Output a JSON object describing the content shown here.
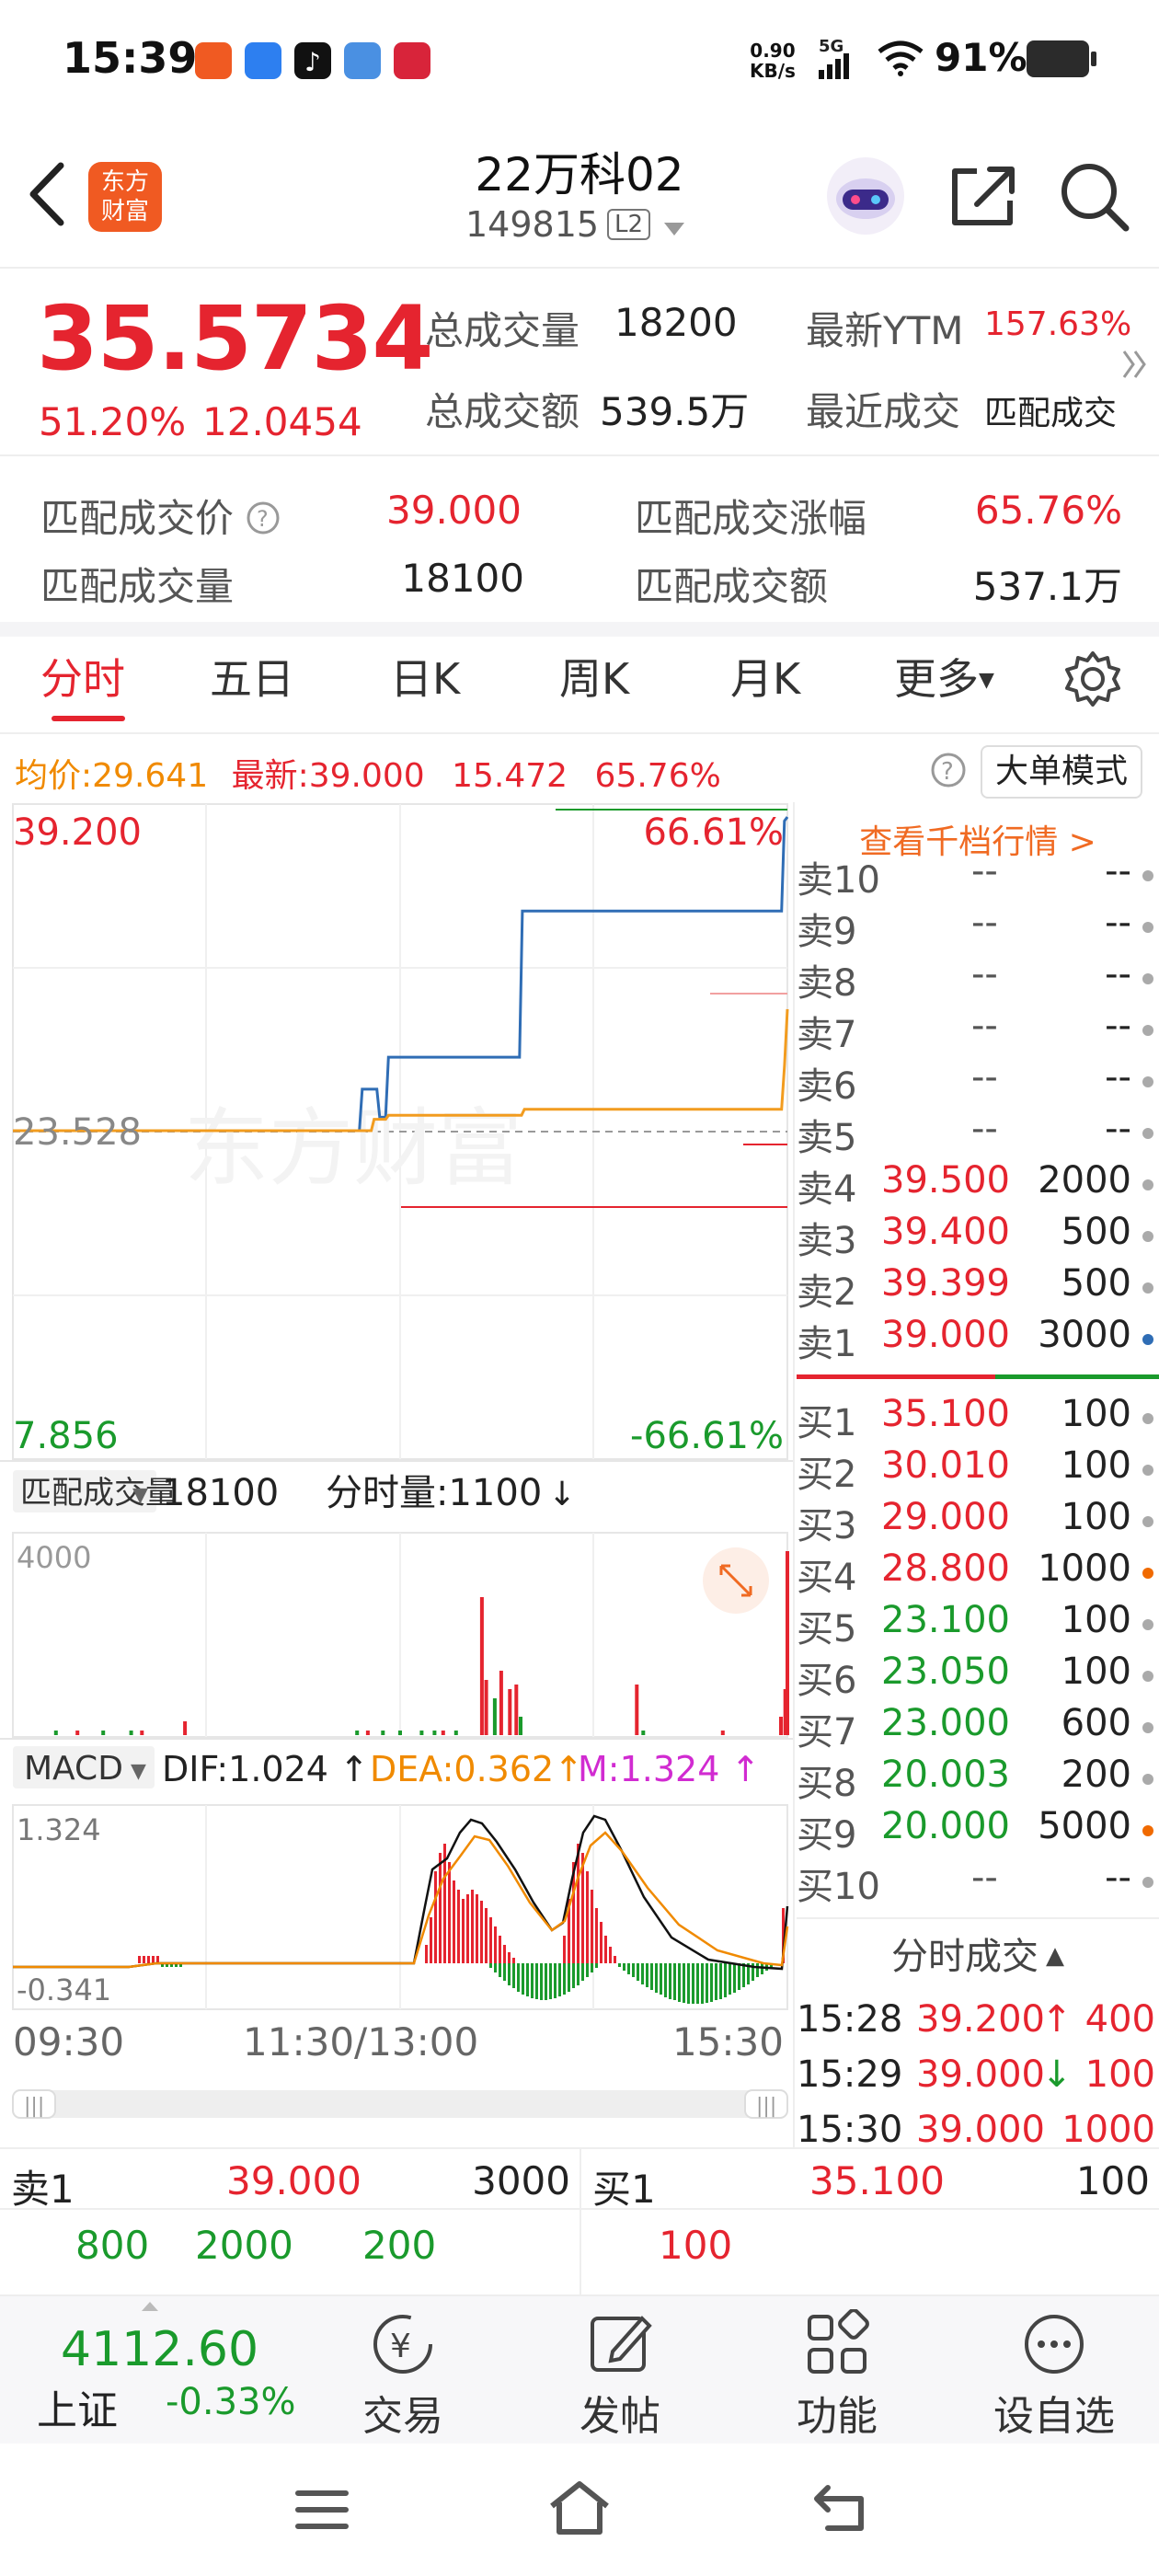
{
  "status_bar": {
    "time": "15:39",
    "net_speed": "0.90",
    "net_unit": "KB/s",
    "signal": "5G",
    "battery": "91%"
  },
  "header": {
    "title": "22万科02",
    "code": "149815",
    "level_badge": "L2",
    "logo_line1": "东方",
    "logo_line2": "财富"
  },
  "quote": {
    "price": "35.5734",
    "change_pct": "51.20%",
    "change_amt": "12.0454",
    "total_volume_label": "总成交量",
    "total_volume": "18200",
    "total_amount_label": "总成交额",
    "total_amount": "539.5万",
    "ytm_label": "最新YTM",
    "ytm": "157.63%",
    "recent_trade_label": "最近成交",
    "recent_trade": "匹配成交"
  },
  "match": {
    "price_label": "匹配成交价",
    "price": "39.000",
    "rise_label": "匹配成交涨幅",
    "rise": "65.76%",
    "volume_label": "匹配成交量",
    "volume": "18100",
    "amount_label": "匹配成交额",
    "amount": "537.1万"
  },
  "tabs": [
    "分时",
    "五日",
    "日K",
    "周K",
    "月K",
    "更多"
  ],
  "chart_info": {
    "avg_label": "均价:",
    "avg": "29.641",
    "latest_label": "最新:",
    "latest": "39.000",
    "chg": "15.472",
    "chg_pct": "65.76%",
    "mode_button": "大单模式",
    "orderbook_link": "查看千档行情 >"
  },
  "chart_data": [
    {
      "type": "line",
      "y_top": "39.200",
      "y_mid": "23.528",
      "y_bottom": "7.856",
      "pct_top": "66.61%",
      "pct_bottom": "-66.61%",
      "watermark": "东方财富",
      "ylim": [
        7.856,
        39.2
      ],
      "x_labels": [
        "09:30",
        "11:30/13:00",
        "15:30"
      ],
      "series": [
        {
          "color": "#2f6db5",
          "values": [
            23.528,
            23.528,
            23.528,
            23.528,
            23.528,
            23.528,
            23.528,
            23.528,
            23.528,
            23.528,
            23.528,
            23.528,
            23.528,
            23.528,
            23.528,
            23.528,
            23.528,
            23.528,
            23.528,
            23.528,
            23.528,
            23.528,
            23.528,
            23.528,
            23.528,
            23.528,
            23.528,
            23.528,
            23.528,
            23.528,
            23.528,
            23.528,
            23.528,
            23.528,
            23.528,
            23.528,
            23.528,
            23.528,
            23.528,
            23.528,
            23.528,
            23.528,
            23.528,
            23.528,
            23.528,
            23.528,
            23.528,
            23.528,
            23.528,
            23.528,
            23.528,
            23.528,
            23.528,
            23.528,
            23.528,
            23.528,
            23.528,
            23.528,
            23.528,
            23.528,
            23.528,
            23.528,
            23.528,
            23.528,
            23.528,
            23.528,
            23.528,
            23.528,
            23.528,
            23.528,
            23.528,
            23.528,
            23.528,
            23.528,
            23.528,
            23.528,
            23.528,
            23.528,
            23.528,
            23.528,
            23.528,
            23.528,
            23.528,
            23.528,
            23.528,
            23.528,
            23.528,
            23.528,
            23.528,
            23.528,
            23.528,
            23.528,
            23.528,
            23.528,
            23.528,
            23.528,
            23.528,
            23.528,
            23.528,
            23.528,
            23.528,
            23.528,
            23.528,
            23.528,
            23.528,
            23.528,
            23.528,
            23.528,
            23.528,
            23.528,
            23.528,
            23.528,
            23.528,
            23.528,
            23.528,
            23.528,
            23.528,
            23.528,
            23.528,
            23.528,
            25.6,
            25.6,
            25.6,
            25.6,
            25.6,
            25.6,
            24.2,
            24.2,
            24.2,
            27.2,
            27.2,
            27.2,
            27.2,
            27.2,
            27.2,
            27.2,
            27.2,
            27.2,
            27.2,
            27.2,
            27.2,
            27.2,
            27.2,
            27.2,
            27.2,
            27.2,
            27.2,
            27.2,
            27.2,
            27.2,
            27.2,
            27.2,
            27.2,
            27.2,
            27.2,
            27.2,
            27.2,
            27.2,
            27.2,
            27.2,
            27.2,
            27.2,
            27.2,
            27.2,
            27.2,
            27.2,
            27.2,
            27.2,
            27.2,
            27.2,
            27.2,
            27.2,
            27.2,
            27.2,
            27.2,
            34.5,
            34.5,
            34.5,
            34.5,
            34.5,
            34.5,
            34.5,
            34.5,
            34.5,
            34.5,
            34.5,
            34.5,
            34.5,
            34.5,
            34.5,
            34.5,
            34.5,
            34.5,
            34.5,
            34.5,
            34.5,
            34.5,
            34.5,
            34.5,
            34.5,
            34.5,
            34.5,
            34.5,
            34.5,
            34.5,
            34.5,
            34.5,
            34.5,
            34.5,
            34.5,
            34.5,
            34.5,
            34.5,
            34.5,
            34.5,
            34.5,
            34.5,
            34.5,
            34.5,
            34.5,
            34.5,
            34.5,
            34.5,
            34.5,
            34.5,
            34.5,
            34.5,
            34.5,
            34.5,
            34.5,
            34.5,
            34.5,
            34.5,
            34.5,
            34.5,
            34.5,
            34.5,
            34.5,
            34.5,
            34.5,
            34.5,
            34.5,
            34.5,
            34.5,
            34.5,
            34.5,
            34.5,
            34.5,
            34.5,
            34.5,
            34.5,
            34.5,
            34.5,
            34.5,
            34.5,
            34.5,
            34.5,
            34.5,
            34.5,
            34.5,
            34.5,
            34.5,
            34.5,
            34.5,
            34.5,
            39.0,
            39.2
          ]
        },
        {
          "color": "#f29c1f",
          "values": [
            23.528,
            23.528,
            23.528,
            23.528,
            23.528,
            23.528,
            23.528,
            23.528,
            23.528,
            23.528,
            23.528,
            23.528,
            23.528,
            23.528,
            23.528,
            23.528,
            23.528,
            23.528,
            23.528,
            23.528,
            23.528,
            23.528,
            23.528,
            23.528,
            23.528,
            23.528,
            23.528,
            23.528,
            23.528,
            23.528,
            23.528,
            23.528,
            23.528,
            23.528,
            23.528,
            23.528,
            23.528,
            23.528,
            23.528,
            23.528,
            23.528,
            23.528,
            23.528,
            23.528,
            23.528,
            23.528,
            23.528,
            23.528,
            23.528,
            23.528,
            23.528,
            23.528,
            23.528,
            23.528,
            23.528,
            23.528,
            23.528,
            23.528,
            23.528,
            23.528,
            23.528,
            23.528,
            23.528,
            23.528,
            23.528,
            23.528,
            23.528,
            23.528,
            23.528,
            23.528,
            23.528,
            23.528,
            23.528,
            23.528,
            23.528,
            23.528,
            23.528,
            23.528,
            23.528,
            23.528,
            23.528,
            23.528,
            23.528,
            23.528,
            23.528,
            23.528,
            23.528,
            23.528,
            23.528,
            23.528,
            23.528,
            23.528,
            23.528,
            23.528,
            23.528,
            23.528,
            23.528,
            23.528,
            23.528,
            23.528,
            23.528,
            23.528,
            23.528,
            23.528,
            23.528,
            23.528,
            23.528,
            23.528,
            23.528,
            23.528,
            23.528,
            23.528,
            23.528,
            23.528,
            23.528,
            23.528,
            23.528,
            23.528,
            23.528,
            23.528,
            23.528,
            23.528,
            23.528,
            23.528,
            23.528,
            24.1,
            24.1,
            24.1,
            24.1,
            24.1,
            24.3,
            24.3,
            24.3,
            24.3,
            24.3,
            24.3,
            24.3,
            24.3,
            24.3,
            24.3,
            24.3,
            24.3,
            24.3,
            24.3,
            24.3,
            24.3,
            24.3,
            24.3,
            24.3,
            24.3,
            24.3,
            24.3,
            24.3,
            24.3,
            24.3,
            24.3,
            24.3,
            24.3,
            24.3,
            24.3,
            24.3,
            24.3,
            24.3,
            24.3,
            24.3,
            24.3,
            24.3,
            24.3,
            24.3,
            24.3,
            24.3,
            24.3,
            24.3,
            24.3,
            24.3,
            24.3,
            24.3,
            24.6,
            24.6,
            24.6,
            24.6,
            24.6,
            24.6,
            24.6,
            24.6,
            24.6,
            24.6,
            24.6,
            24.6,
            24.6,
            24.6,
            24.6,
            24.6,
            24.6,
            24.6,
            24.6,
            24.6,
            24.6,
            24.6,
            24.6,
            24.6,
            24.6,
            24.6,
            24.6,
            24.6,
            24.6,
            24.6,
            24.6,
            24.6,
            24.6,
            24.6,
            24.6,
            24.6,
            24.6,
            24.6,
            24.6,
            24.6,
            24.6,
            24.6,
            24.6,
            24.6,
            24.6,
            24.6,
            24.6,
            24.6,
            24.6,
            24.6,
            24.6,
            24.6,
            24.6,
            24.6,
            24.6,
            24.6,
            24.6,
            24.6,
            24.6,
            24.6,
            24.6,
            24.6,
            24.6,
            24.6,
            24.6,
            24.6,
            24.6,
            24.6,
            24.6,
            24.6,
            24.6,
            24.6,
            24.6,
            24.6,
            24.6,
            24.6,
            24.6,
            24.6,
            24.6,
            24.6,
            24.6,
            24.6,
            24.6,
            24.6,
            24.6,
            24.6,
            24.6,
            24.6,
            24.6,
            24.6,
            26.8,
            29.6
          ]
        }
      ]
    },
    {
      "type": "bar",
      "title": "匹配成交量",
      "total": "18100",
      "per_minute_label": "分时量:1100",
      "ymax_label": "4000",
      "ylim": [
        0,
        4000
      ],
      "bars": [
        {
          "x": 20,
          "v": 100,
          "c": "g"
        },
        {
          "x": 30,
          "v": 100,
          "c": "r"
        },
        {
          "x": 42,
          "v": 100,
          "c": "g"
        },
        {
          "x": 55,
          "v": 100,
          "c": "g"
        },
        {
          "x": 60,
          "v": 100,
          "c": "r"
        },
        {
          "x": 80,
          "v": 300,
          "c": "r"
        },
        {
          "x": 160,
          "v": 100,
          "c": "g"
        },
        {
          "x": 165,
          "v": 100,
          "c": "r"
        },
        {
          "x": 172,
          "v": 100,
          "c": "g"
        },
        {
          "x": 180,
          "v": 100,
          "c": "g"
        },
        {
          "x": 190,
          "v": 100,
          "c": "g"
        },
        {
          "x": 196,
          "v": 100,
          "c": "g"
        },
        {
          "x": 200,
          "v": 100,
          "c": "r"
        },
        {
          "x": 206,
          "v": 100,
          "c": "g"
        },
        {
          "x": 218,
          "v": 3000,
          "c": "r"
        },
        {
          "x": 220,
          "v": 1200,
          "c": "r"
        },
        {
          "x": 224,
          "v": 800,
          "c": "g"
        },
        {
          "x": 227,
          "v": 1400,
          "c": "r"
        },
        {
          "x": 231,
          "v": 1000,
          "c": "r"
        },
        {
          "x": 234,
          "v": 1100,
          "c": "r"
        },
        {
          "x": 236,
          "v": 400,
          "c": "g"
        },
        {
          "x": 290,
          "v": 1100,
          "c": "r"
        },
        {
          "x": 293,
          "v": 100,
          "c": "g"
        },
        {
          "x": 330,
          "v": 100,
          "c": "r"
        },
        {
          "x": 357,
          "v": 400,
          "c": "r"
        },
        {
          "x": 359,
          "v": 1000,
          "c": "r"
        },
        {
          "x": 360,
          "v": 4000,
          "c": "r"
        }
      ]
    },
    {
      "type": "line",
      "title": "MACD",
      "dif_label": "DIF:1.024",
      "dea_label": "DEA:0.362",
      "m_label": "M:1.324",
      "ymax_label": "1.324",
      "ymin_label": "-0.341",
      "ylim": [
        -0.341,
        1.324
      ]
    }
  ],
  "orderbook": {
    "asks": [
      {
        "label": "卖10",
        "price": "--",
        "vol": "--",
        "dot": "#aaaaaa"
      },
      {
        "label": "卖9",
        "price": "--",
        "vol": "--",
        "dot": "#aaaaaa"
      },
      {
        "label": "卖8",
        "price": "--",
        "vol": "--",
        "dot": "#aaaaaa"
      },
      {
        "label": "卖7",
        "price": "--",
        "vol": "--",
        "dot": "#aaaaaa"
      },
      {
        "label": "卖6",
        "price": "--",
        "vol": "--",
        "dot": "#aaaaaa"
      },
      {
        "label": "卖5",
        "price": "--",
        "vol": "--",
        "dot": "#aaaaaa"
      },
      {
        "label": "卖4",
        "price": "39.500",
        "vol": "2000",
        "dot": "#aaaaaa"
      },
      {
        "label": "卖3",
        "price": "39.400",
        "vol": "500",
        "dot": "#aaaaaa"
      },
      {
        "label": "卖2",
        "price": "39.399",
        "vol": "500",
        "dot": "#aaaaaa"
      },
      {
        "label": "卖1",
        "price": "39.000",
        "vol": "3000",
        "dot": "#2f6db5"
      }
    ],
    "bids": [
      {
        "label": "买1",
        "price": "35.100",
        "vol": "100",
        "color": "red",
        "dot": "#aaaaaa"
      },
      {
        "label": "买2",
        "price": "30.010",
        "vol": "100",
        "color": "red",
        "dot": "#aaaaaa"
      },
      {
        "label": "买3",
        "price": "29.000",
        "vol": "100",
        "color": "red",
        "dot": "#aaaaaa"
      },
      {
        "label": "买4",
        "price": "28.800",
        "vol": "1000",
        "color": "red",
        "dot": "#f06a00"
      },
      {
        "label": "买5",
        "price": "23.100",
        "vol": "100",
        "color": "green",
        "dot": "#aaaaaa"
      },
      {
        "label": "买6",
        "price": "23.050",
        "vol": "100",
        "color": "green",
        "dot": "#aaaaaa"
      },
      {
        "label": "买7",
        "price": "23.000",
        "vol": "600",
        "color": "green",
        "dot": "#aaaaaa"
      },
      {
        "label": "买8",
        "price": "20.003",
        "vol": "200",
        "color": "green",
        "dot": "#aaaaaa"
      },
      {
        "label": "买9",
        "price": "20.000",
        "vol": "5000",
        "color": "green",
        "dot": "#f06a00"
      },
      {
        "label": "买10",
        "price": "--",
        "vol": "--",
        "color": "gray",
        "dot": "#aaaaaa"
      }
    ]
  },
  "trades": {
    "title": "分时成交",
    "rows": [
      {
        "time": "15:28",
        "price": "39.200",
        "arrow": "↑",
        "vol": "400",
        "vol_color": "red"
      },
      {
        "time": "15:29",
        "price": "39.000",
        "arrow": "↓",
        "vol": "100",
        "vol_color": "red"
      },
      {
        "time": "15:30",
        "price": "39.000",
        "arrow": "",
        "vol": "1000",
        "vol_color": "red"
      }
    ]
  },
  "level1": {
    "ask_label": "卖1",
    "ask_price": "39.000",
    "ask_vol": "3000",
    "bid_label": "买1",
    "bid_price": "35.100",
    "bid_vol": "100",
    "ask_details": [
      "800",
      "2000",
      "200"
    ],
    "bid_details": [
      "100"
    ]
  },
  "bottom_nav": {
    "index_value": "4112.60",
    "index_name": "上证",
    "index_change": "-0.33%",
    "items": [
      "交易",
      "发帖",
      "功能",
      "设自选"
    ]
  }
}
